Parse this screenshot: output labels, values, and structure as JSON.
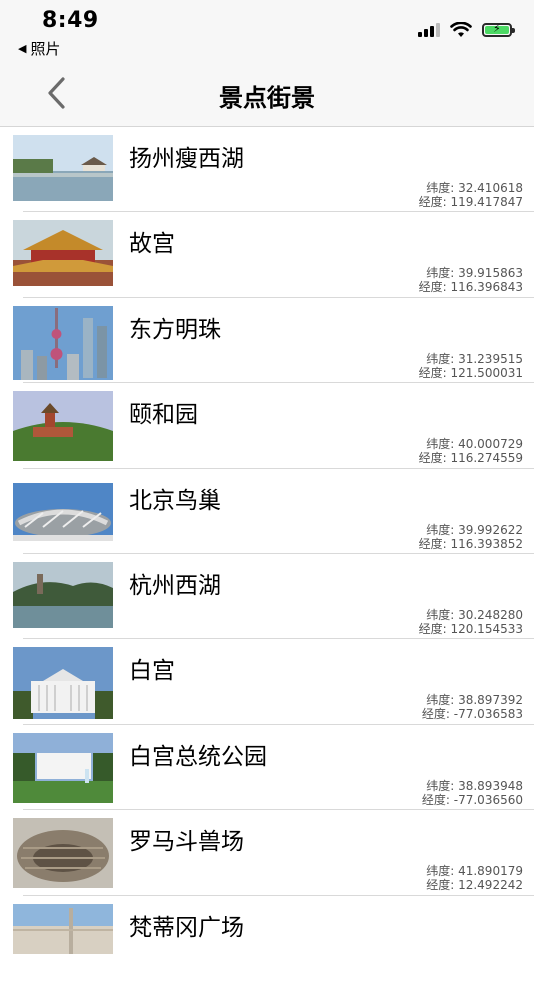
{
  "status": {
    "time": "8:49",
    "back_app_label": "照片"
  },
  "nav": {
    "title": "景点街景"
  },
  "places": [
    {
      "name": "扬州瘦西湖",
      "lat": "纬度: 32.410618",
      "lon": "经度: 119.417847",
      "thumb": "lake-pavilion"
    },
    {
      "name": "故宫",
      "lat": "纬度: 39.915863",
      "lon": "经度: 116.396843",
      "thumb": "palace"
    },
    {
      "name": "东方明珠",
      "lat": "纬度: 31.239515",
      "lon": "经度: 121.500031",
      "thumb": "tv-tower"
    },
    {
      "name": "颐和园",
      "lat": "纬度: 40.000729",
      "lon": "经度: 116.274559",
      "thumb": "hill-pagoda"
    },
    {
      "name": "北京鸟巢",
      "lat": "纬度: 39.992622",
      "lon": "经度: 116.393852",
      "thumb": "stadium"
    },
    {
      "name": "杭州西湖",
      "lat": "纬度: 30.248280",
      "lon": "经度: 120.154533",
      "thumb": "west-lake"
    },
    {
      "name": "白宫",
      "lat": "纬度: 38.897392",
      "lon": "经度: -77.036583",
      "thumb": "white-house"
    },
    {
      "name": "白宫总统公园",
      "lat": "纬度: 38.893948",
      "lon": "经度: -77.036560",
      "thumb": "white-house-park"
    },
    {
      "name": "罗马斗兽场",
      "lat": "纬度: 41.890179",
      "lon": "经度: 12.492242",
      "thumb": "colosseum"
    },
    {
      "name": "梵蒂冈广场",
      "lat": "",
      "lon": "",
      "thumb": "vatican"
    }
  ]
}
